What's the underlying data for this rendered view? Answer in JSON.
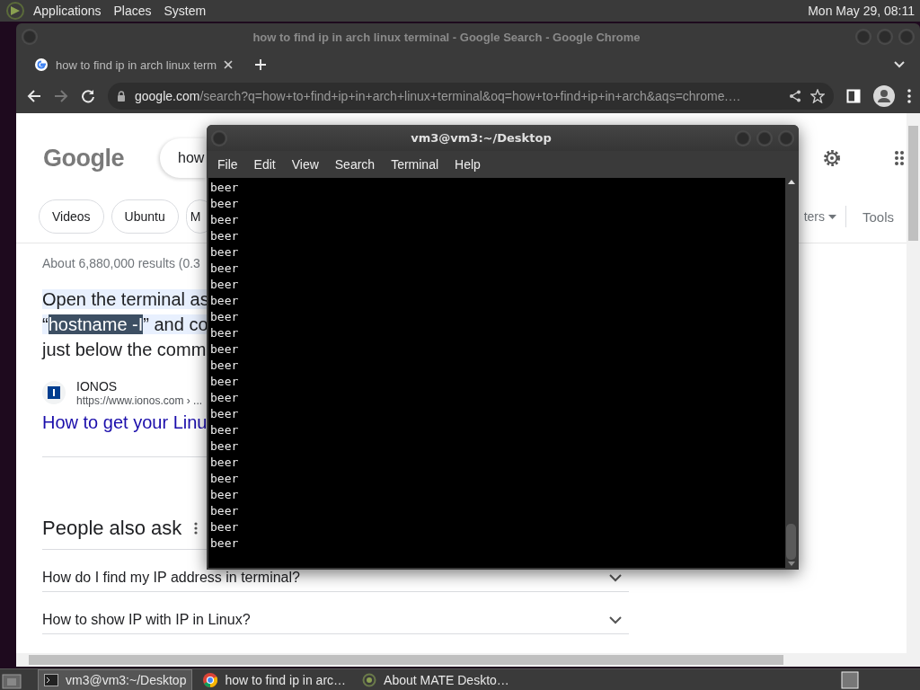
{
  "top_panel": {
    "menus": [
      "Applications",
      "Places",
      "System"
    ],
    "clock": "Mon May 29, 08:11"
  },
  "browser": {
    "title": "how to find ip in arch linux terminal - Google Search - Google Chrome",
    "tabs": [
      {
        "label": "how to find ip in arch linux term",
        "selected": true
      }
    ],
    "url_host": "google.com",
    "url_path": "/search?q=how+to+find+ip+in+arch+linux+terminal&oq=how+to+find+ip+in+arch&aqs=chrome.…",
    "logo": "Google",
    "search_value": "how",
    "chips": [
      "Videos",
      "Ubuntu",
      "M"
    ],
    "filters_label": "ters",
    "tools_label": "Tools",
    "result_stats": "About 6,880,000 results (0.3",
    "snippet": {
      "line_1": "Open the terminal as",
      "line_2_start": "“",
      "highlight": "hostname -I",
      "line_2_end": "” and co",
      "line_3": "just below the comm"
    },
    "source": {
      "name": "IONOS",
      "url": "https://www.ionos.com › ..."
    },
    "result_link": "How to get your Linu",
    "people_also_ask": {
      "heading": "People also ask",
      "questions": [
        "How do I find my IP address in terminal?",
        "How to show IP with IP in Linux?"
      ]
    }
  },
  "terminal": {
    "title": "vm3@vm3:~/Desktop",
    "menus": [
      "File",
      "Edit",
      "View",
      "Search",
      "Terminal",
      "Help"
    ],
    "lines": [
      "beer",
      "beer",
      "beer",
      "beer",
      "beer",
      "beer",
      "beer",
      "beer",
      "beer",
      "beer",
      "beer",
      "beer",
      "beer",
      "beer",
      "beer",
      "beer",
      "beer",
      "beer",
      "beer",
      "beer",
      "beer",
      "beer",
      "beer"
    ]
  },
  "taskbar": {
    "tasks": [
      {
        "label": "vm3@vm3:~/Desktop",
        "selected": true,
        "kind": "terminal"
      },
      {
        "label": "how to find ip in arc…",
        "selected": false,
        "kind": "browser"
      },
      {
        "label": "About MATE Deskto…",
        "selected": false,
        "kind": "mate"
      }
    ]
  }
}
